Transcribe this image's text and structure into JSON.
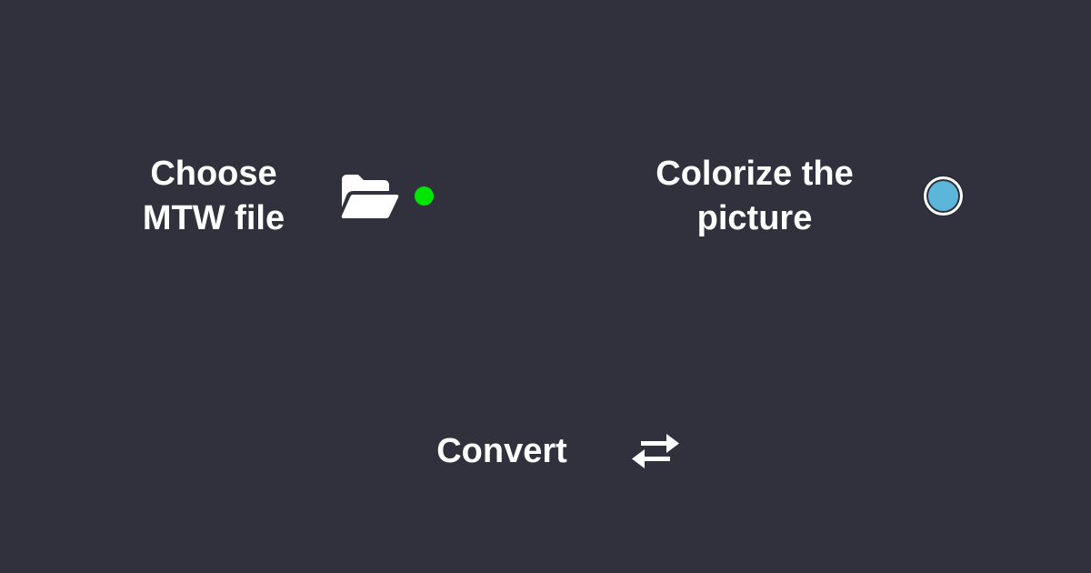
{
  "choose_file": {
    "label_line1": "Choose",
    "label_line2": "MTW file",
    "icon": "folder-open-icon",
    "status": "file-selected",
    "status_color": "#00e600"
  },
  "colorize": {
    "label_line1": "Colorize the",
    "label_line2": "picture",
    "toggle_color": "#5bb6d9"
  },
  "convert": {
    "label": "Convert",
    "icon": "swap-arrows-icon"
  },
  "theme": {
    "background": "#30313d",
    "text": "#ffffff"
  }
}
